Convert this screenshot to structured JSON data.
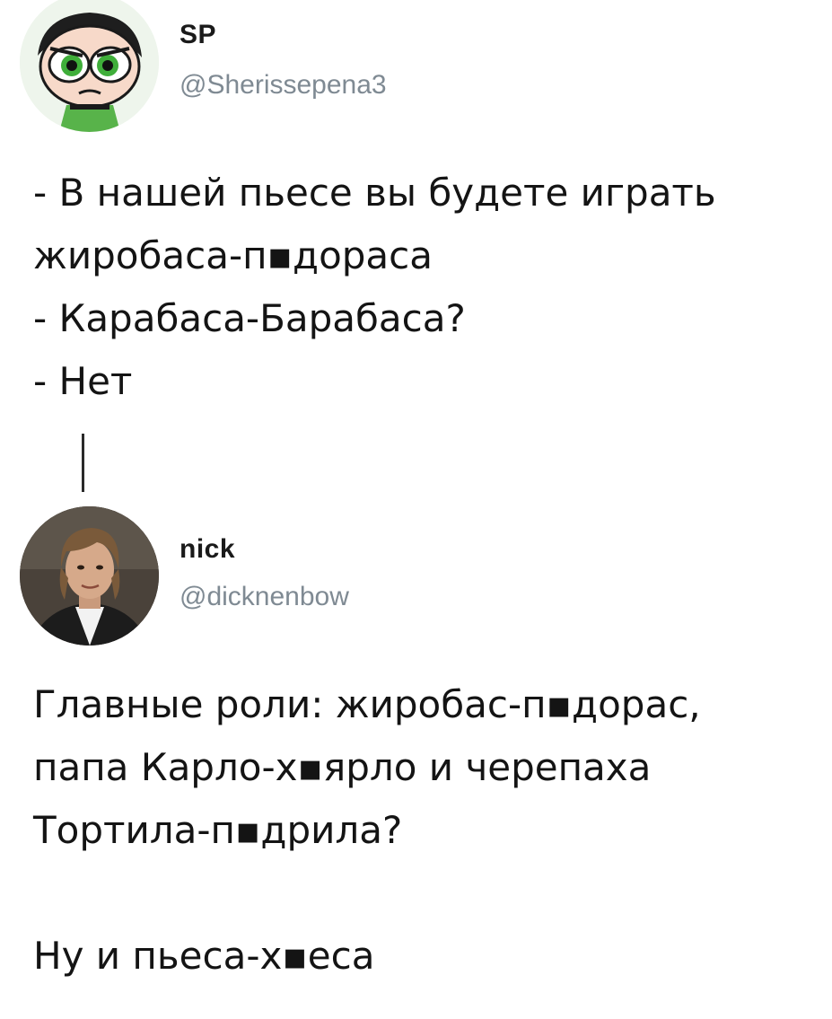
{
  "tweets": [
    {
      "display_name": "SP",
      "handle": "@Sherissepena3",
      "avatar_icon": "powerpuff-buttercup-avatar-icon",
      "text": "- В нашей пьесе вы будете играть\nжиробаса-п▪дораса\n- Карабаса-Барабаса?\n- Нет"
    },
    {
      "display_name": "nick",
      "handle": "@dicknenbow",
      "avatar_icon": "man-portrait-avatar-icon",
      "text": "Главные роли: жиробас-п▪дорас,\nпапа Карло-х▪ярло и черепаха\nТортила-п▪дрила?\n\nНу и пьеса-х▪еса"
    }
  ],
  "colors": {
    "text": "#141414",
    "handle": "#7f8a93",
    "thread_line": "#2a2a2a",
    "background": "#ffffff"
  }
}
